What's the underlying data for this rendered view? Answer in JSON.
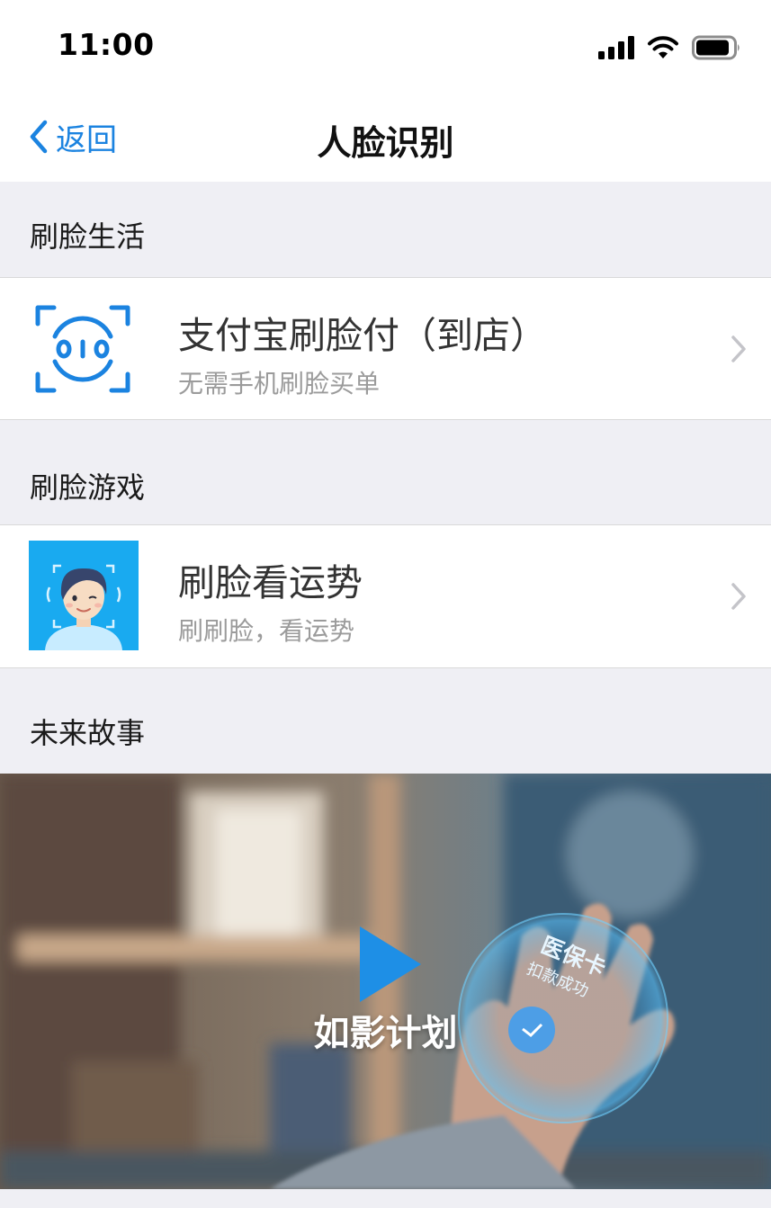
{
  "status_bar": {
    "time": "11:00"
  },
  "nav": {
    "back_label": "返回",
    "title": "人脸识别"
  },
  "sections": [
    {
      "header": "刷脸生活",
      "items": [
        {
          "title": "支付宝刷脸付（到店）",
          "subtitle": "无需手机刷脸买单",
          "icon": "face-scan-icon"
        }
      ]
    },
    {
      "header": "刷脸游戏",
      "items": [
        {
          "title": "刷脸看运势",
          "subtitle": "刷刷脸，看运势",
          "icon": "face-fortune-avatar"
        }
      ]
    },
    {
      "header": "未来故事",
      "video": {
        "title": "如影计划",
        "overlay_lines": [
          "医保卡",
          "扣款成功"
        ]
      }
    }
  ],
  "colors": {
    "accent": "#1b83e0",
    "background": "#efeff4",
    "video_play": "#1e8fe6"
  }
}
